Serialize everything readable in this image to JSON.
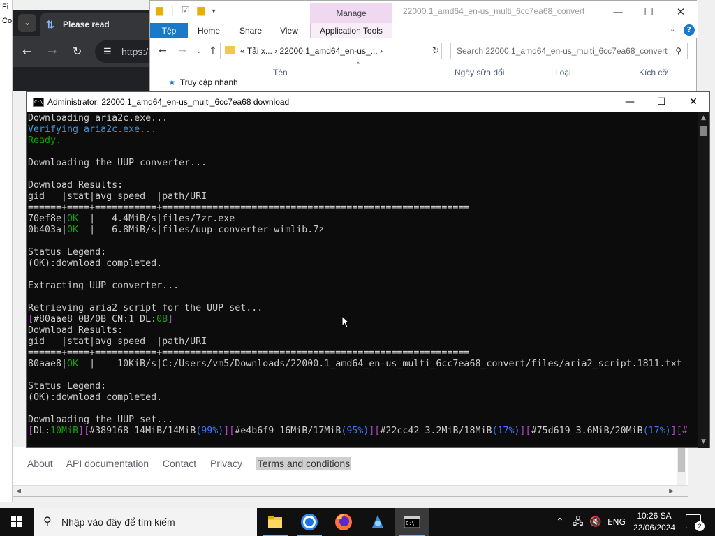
{
  "browser": {
    "tab_title": "Please read",
    "address_text": "https:/",
    "left_strip_text": [
      "Fi",
      "Co"
    ]
  },
  "explorer": {
    "title": "22000.1_amd64_en-us_multi_6cc7ea68_convert",
    "manage_label": "Manage",
    "tabs": [
      "Tệp",
      "Home",
      "Share",
      "View",
      "Application Tools"
    ],
    "address_parts": [
      "«",
      "Tải x...",
      "›",
      "22000.1_amd64_en-us_...",
      "›"
    ],
    "search_placeholder": "Search 22000.1_amd64_en-us_multi_6cc7ea68_convert",
    "columns": [
      "Tên",
      "Ngày sửa đổi",
      "Loại",
      "Kích cỡ"
    ],
    "quick_access": "Truy cập nhanh"
  },
  "cmd": {
    "title": "Administrator:  22000.1_amd64_en-us_multi_6cc7ea68 download",
    "lines": [
      [
        {
          "t": "Downloading aria2c.exe..."
        }
      ],
      [
        {
          "t": "Verifying aria2c.exe...",
          "c": "c-cyan"
        }
      ],
      [
        {
          "t": "Ready.",
          "c": "c-green"
        }
      ],
      [
        {
          "t": ""
        }
      ],
      [
        {
          "t": "Downloading the UUP converter..."
        }
      ],
      [
        {
          "t": ""
        }
      ],
      [
        {
          "t": "Download Results:"
        }
      ],
      [
        {
          "t": "gid   |stat|avg speed  |path/URI"
        }
      ],
      [
        {
          "t": "======+====+===========+======================================================="
        }
      ],
      [
        {
          "t": "70ef8e|"
        },
        {
          "t": "OK",
          "c": "c-green"
        },
        {
          "t": "  |   4.4MiB/s|files/7zr.exe"
        }
      ],
      [
        {
          "t": "0b403a|"
        },
        {
          "t": "OK",
          "c": "c-green"
        },
        {
          "t": "  |   6.8MiB/s|files/uup-converter-wimlib.7z"
        }
      ],
      [
        {
          "t": ""
        }
      ],
      [
        {
          "t": "Status Legend:"
        }
      ],
      [
        {
          "t": "(OK):download completed."
        }
      ],
      [
        {
          "t": ""
        }
      ],
      [
        {
          "t": "Extracting UUP converter..."
        }
      ],
      [
        {
          "t": ""
        }
      ],
      [
        {
          "t": "Retrieving aria2 script for the UUP set..."
        }
      ],
      [
        {
          "t": "[",
          "c": "c-purple"
        },
        {
          "t": "#80aae8 0B/0B CN:1 DL:"
        },
        {
          "t": "0B",
          "c": "c-green"
        },
        {
          "t": "]",
          "c": "c-purple"
        }
      ],
      [
        {
          "t": "Download Results:"
        }
      ],
      [
        {
          "t": "gid   |stat|avg speed  |path/URI"
        }
      ],
      [
        {
          "t": "======+====+===========+======================================================="
        }
      ],
      [
        {
          "t": "80aae8|"
        },
        {
          "t": "OK",
          "c": "c-green"
        },
        {
          "t": "  |    10KiB/s|C:/Users/vm5/Downloads/22000.1_amd64_en-us_multi_6cc7ea68_convert/files/aria2_script.1811.txt"
        }
      ],
      [
        {
          "t": ""
        }
      ],
      [
        {
          "t": "Status Legend:"
        }
      ],
      [
        {
          "t": "(OK):download completed."
        }
      ],
      [
        {
          "t": ""
        }
      ],
      [
        {
          "t": "Downloading the UUP set..."
        }
      ],
      [
        {
          "t": "[",
          "c": "c-purple"
        },
        {
          "t": "DL:"
        },
        {
          "t": "10MiB",
          "c": "c-green"
        },
        {
          "t": "][",
          "c": "c-purple"
        },
        {
          "t": "#389168 14MiB/14MiB"
        },
        {
          "t": "(99%)",
          "c": "c-blue"
        },
        {
          "t": "][",
          "c": "c-purple"
        },
        {
          "t": "#e4b6f9 16MiB/17MiB"
        },
        {
          "t": "(95%)",
          "c": "c-blue"
        },
        {
          "t": "][",
          "c": "c-purple"
        },
        {
          "t": "#22cc42 3.2MiB/18MiB"
        },
        {
          "t": "(17%)",
          "c": "c-blue"
        },
        {
          "t": "][",
          "c": "c-purple"
        },
        {
          "t": "#75d619 3.6MiB/20MiB"
        },
        {
          "t": "(17%)",
          "c": "c-blue"
        },
        {
          "t": "][#",
          "c": "c-purple"
        }
      ]
    ]
  },
  "footer": {
    "links": [
      "About",
      "API documentation",
      "Contact",
      "Privacy",
      "Terms and conditions"
    ]
  },
  "taskbar": {
    "search_placeholder": "Nhập vào đây để tìm kiếm",
    "apps": [
      "file-explorer-icon",
      "chrome-icon",
      "firefox-icon",
      "app-icon",
      "terminal-icon"
    ],
    "language": "ENG",
    "time": "10:26 SA",
    "date": "22/06/2024",
    "notification_count": "2"
  },
  "colors": {
    "console_bg": "#0c0c0c",
    "console_fg": "#cccccc",
    "ok_green": "#13a10e",
    "percent_blue": "#3b78ff",
    "bracket_purple": "#b148c6",
    "ribbon_blue": "#1979ca",
    "manage_pink": "#f0d8f0"
  }
}
